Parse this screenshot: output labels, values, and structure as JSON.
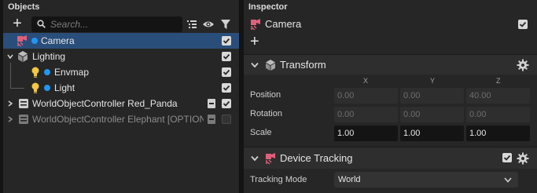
{
  "objects_panel": {
    "title": "Objects",
    "search_placeholder": "Search...",
    "items": [
      {
        "label": "Camera",
        "selected": true,
        "checked": true
      },
      {
        "label": "Lighting",
        "checked": true
      },
      {
        "label": "Envmap",
        "checked": true
      },
      {
        "label": "Light",
        "checked": true
      },
      {
        "label": "WorldObjectController Red_Panda",
        "checked": true
      },
      {
        "label": "WorldObjectController Elephant [OPTION",
        "checked": false
      }
    ]
  },
  "inspector": {
    "title": "Inspector",
    "object_name": "Camera",
    "transform": {
      "title": "Transform",
      "axes": [
        "X",
        "Y",
        "Z"
      ],
      "position": {
        "label": "Position",
        "values": [
          "0.00",
          "0.00",
          "40.00"
        ]
      },
      "rotation": {
        "label": "Rotation",
        "values": [
          "0.00",
          "0.00",
          "0.00"
        ]
      },
      "scale": {
        "label": "Scale",
        "values": [
          "1.00",
          "1.00",
          "1.00"
        ]
      }
    },
    "device_tracking": {
      "title": "Device Tracking",
      "mode_label": "Tracking Mode",
      "mode_value": "World"
    }
  },
  "colors": {
    "selection": "#2a4e7a",
    "accent_dot": "#2196f3",
    "camera_icon": "#e0607a",
    "light_icon": "#f2c744"
  }
}
